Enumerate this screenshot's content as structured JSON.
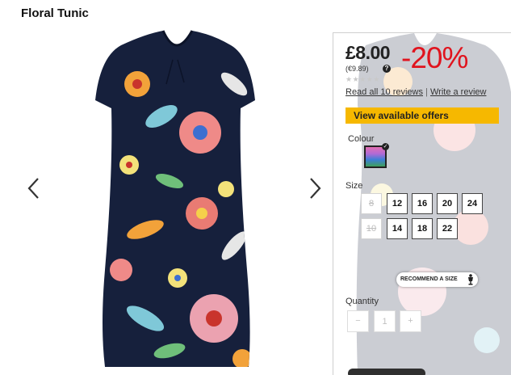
{
  "product": {
    "title": "Floral Tunic",
    "price": "£8.00",
    "price_euro": "(€9.89)",
    "discount": "-20%",
    "rating_stars": "★★★★★",
    "read_reviews": "Read all 10 reviews",
    "separator": "|",
    "write_review": "Write a review"
  },
  "offers_button": "View available offers",
  "colour": {
    "label": "Colour",
    "selected_icon": "check-icon"
  },
  "size": {
    "label": "Size",
    "options": [
      {
        "value": "8",
        "available": false
      },
      {
        "value": "12",
        "available": true
      },
      {
        "value": "16",
        "available": true
      },
      {
        "value": "20",
        "available": true
      },
      {
        "value": "24",
        "available": true
      },
      {
        "value": "10",
        "available": false
      },
      {
        "value": "14",
        "available": true
      },
      {
        "value": "18",
        "available": true
      },
      {
        "value": "22",
        "available": true
      }
    ]
  },
  "recommend_button": "RECOMMEND A SIZE",
  "quantity": {
    "label": "Quantity",
    "minus": "−",
    "value": "1",
    "plus": "+"
  },
  "colors": {
    "discount": "#e0141e",
    "offers_button": "#f6b800",
    "dress_base": "#16203c"
  }
}
